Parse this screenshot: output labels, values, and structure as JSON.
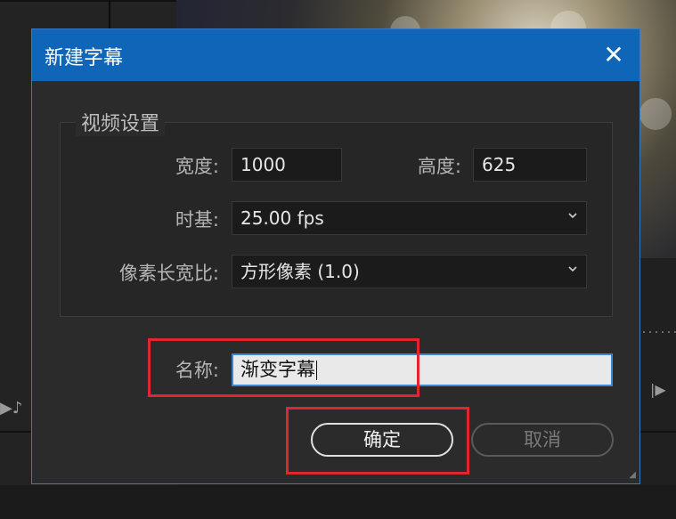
{
  "dialog": {
    "title": "新建字幕",
    "close_symbol": "✕"
  },
  "video_settings": {
    "legend": "视频设置",
    "width_label": "宽度:",
    "width_value": "1000",
    "height_label": "高度:",
    "height_value": "625",
    "timebase_label": "时基:",
    "timebase_value": "25.00 fps",
    "pixel_aspect_label": "像素长宽比:",
    "pixel_aspect_value": "方形像素 (1.0)"
  },
  "name": {
    "label": "名称:",
    "value": "渐变字幕"
  },
  "buttons": {
    "ok": "确定",
    "cancel": "取消"
  },
  "colors": {
    "titlebar": "#0f66b8",
    "highlight": "#e0262e"
  },
  "icons": [
    "close-icon",
    "chevron-down-icon"
  ]
}
